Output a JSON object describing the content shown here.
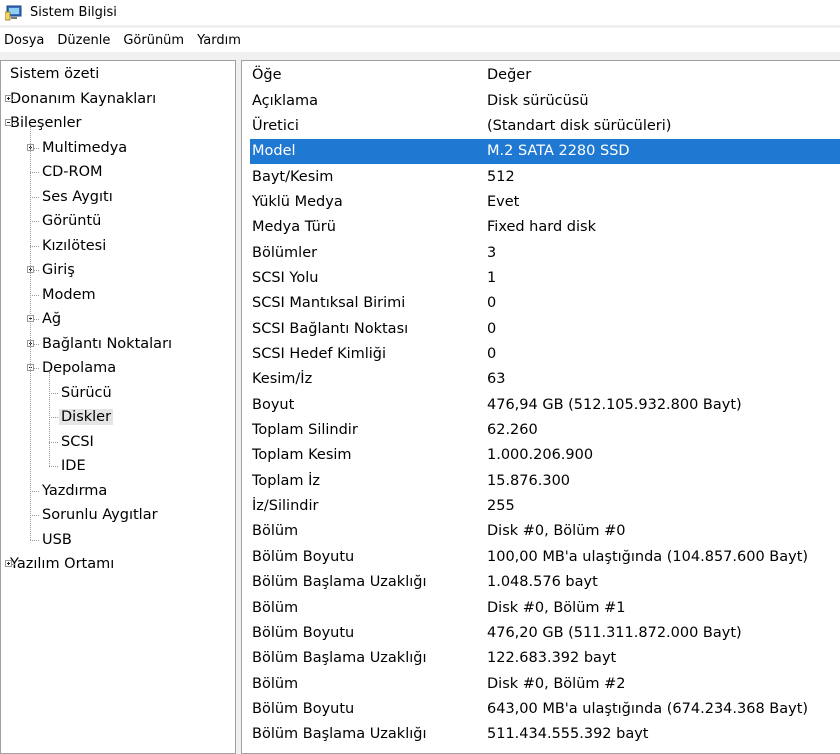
{
  "window": {
    "title": "Sistem Bilgisi",
    "icon": "system-info-icon"
  },
  "menu": [
    "Dosya",
    "Düzenle",
    "Görünüm",
    "Yardım"
  ],
  "tree": [
    {
      "label": "Sistem özeti",
      "depth": 0,
      "expander": "none"
    },
    {
      "label": "Donanım Kaynakları",
      "depth": 0,
      "expander": "plus"
    },
    {
      "label": "Bileşenler",
      "depth": 0,
      "expander": "minus"
    },
    {
      "label": "Multimedya",
      "depth": 1,
      "expander": "plus"
    },
    {
      "label": "CD-ROM",
      "depth": 1,
      "expander": "none"
    },
    {
      "label": "Ses Aygıtı",
      "depth": 1,
      "expander": "none"
    },
    {
      "label": "Görüntü",
      "depth": 1,
      "expander": "none"
    },
    {
      "label": "Kızılötesi",
      "depth": 1,
      "expander": "none"
    },
    {
      "label": "Giriş",
      "depth": 1,
      "expander": "plus"
    },
    {
      "label": "Modem",
      "depth": 1,
      "expander": "none"
    },
    {
      "label": "Ağ",
      "depth": 1,
      "expander": "plus"
    },
    {
      "label": "Bağlantı Noktaları",
      "depth": 1,
      "expander": "plus"
    },
    {
      "label": "Depolama",
      "depth": 1,
      "expander": "minus"
    },
    {
      "label": "Sürücü",
      "depth": 2,
      "expander": "none"
    },
    {
      "label": "Diskler",
      "depth": 2,
      "expander": "none",
      "selected": true
    },
    {
      "label": "SCSI",
      "depth": 2,
      "expander": "none"
    },
    {
      "label": "IDE",
      "depth": 2,
      "expander": "none"
    },
    {
      "label": "Yazdırma",
      "depth": 1,
      "expander": "none"
    },
    {
      "label": "Sorunlu Aygıtlar",
      "depth": 1,
      "expander": "none"
    },
    {
      "label": "USB",
      "depth": 1,
      "expander": "none"
    },
    {
      "label": "Yazılım Ortamı",
      "depth": 0,
      "expander": "plus"
    }
  ],
  "details": {
    "header": {
      "key": "Öğe",
      "value": "Değer"
    },
    "selected_index": 2,
    "rows": [
      {
        "key": "Açıklama",
        "value": "Disk sürücüsü"
      },
      {
        "key": "Üretici",
        "value": "(Standart disk sürücüleri)"
      },
      {
        "key": "Model",
        "value": "M.2 SATA 2280 SSD"
      },
      {
        "key": "Bayt/Kesim",
        "value": "512"
      },
      {
        "key": "Yüklü Medya",
        "value": "Evet"
      },
      {
        "key": "Medya Türü",
        "value": "Fixed hard disk"
      },
      {
        "key": "Bölümler",
        "value": "3"
      },
      {
        "key": "SCSI Yolu",
        "value": "1"
      },
      {
        "key": "SCSI Mantıksal Birimi",
        "value": "0"
      },
      {
        "key": "SCSI Bağlantı Noktası",
        "value": "0"
      },
      {
        "key": "SCSI Hedef Kimliği",
        "value": "0"
      },
      {
        "key": "Kesim/İz",
        "value": "63"
      },
      {
        "key": "Boyut",
        "value": "476,94 GB (512.105.932.800 Bayt)"
      },
      {
        "key": "Toplam Silindir",
        "value": "62.260"
      },
      {
        "key": "Toplam Kesim",
        "value": "1.000.206.900"
      },
      {
        "key": "Toplam İz",
        "value": "15.876.300"
      },
      {
        "key": "İz/Silindir",
        "value": "255"
      },
      {
        "key": "Bölüm",
        "value": "Disk #0, Bölüm #0"
      },
      {
        "key": "Bölüm Boyutu",
        "value": "100,00 MB'a ulaştığında (104.857.600 Bayt)"
      },
      {
        "key": "Bölüm Başlama Uzaklığı",
        "value": "1.048.576 bayt"
      },
      {
        "key": "Bölüm",
        "value": "Disk #0, Bölüm #1"
      },
      {
        "key": "Bölüm Boyutu",
        "value": "476,20 GB (511.311.872.000 Bayt)"
      },
      {
        "key": "Bölüm Başlama Uzaklığı",
        "value": "122.683.392 bayt"
      },
      {
        "key": "Bölüm",
        "value": "Disk #0, Bölüm #2"
      },
      {
        "key": "Bölüm Boyutu",
        "value": "643,00 MB'a ulaştığında (674.234.368 Bayt)"
      },
      {
        "key": "Bölüm Başlama Uzaklığı",
        "value": "511.434.555.392 bayt"
      }
    ]
  },
  "colors": {
    "selection": "#1f78d1",
    "tree_selection": "#e5e5e5",
    "window_bg": "#f0f0f0"
  }
}
